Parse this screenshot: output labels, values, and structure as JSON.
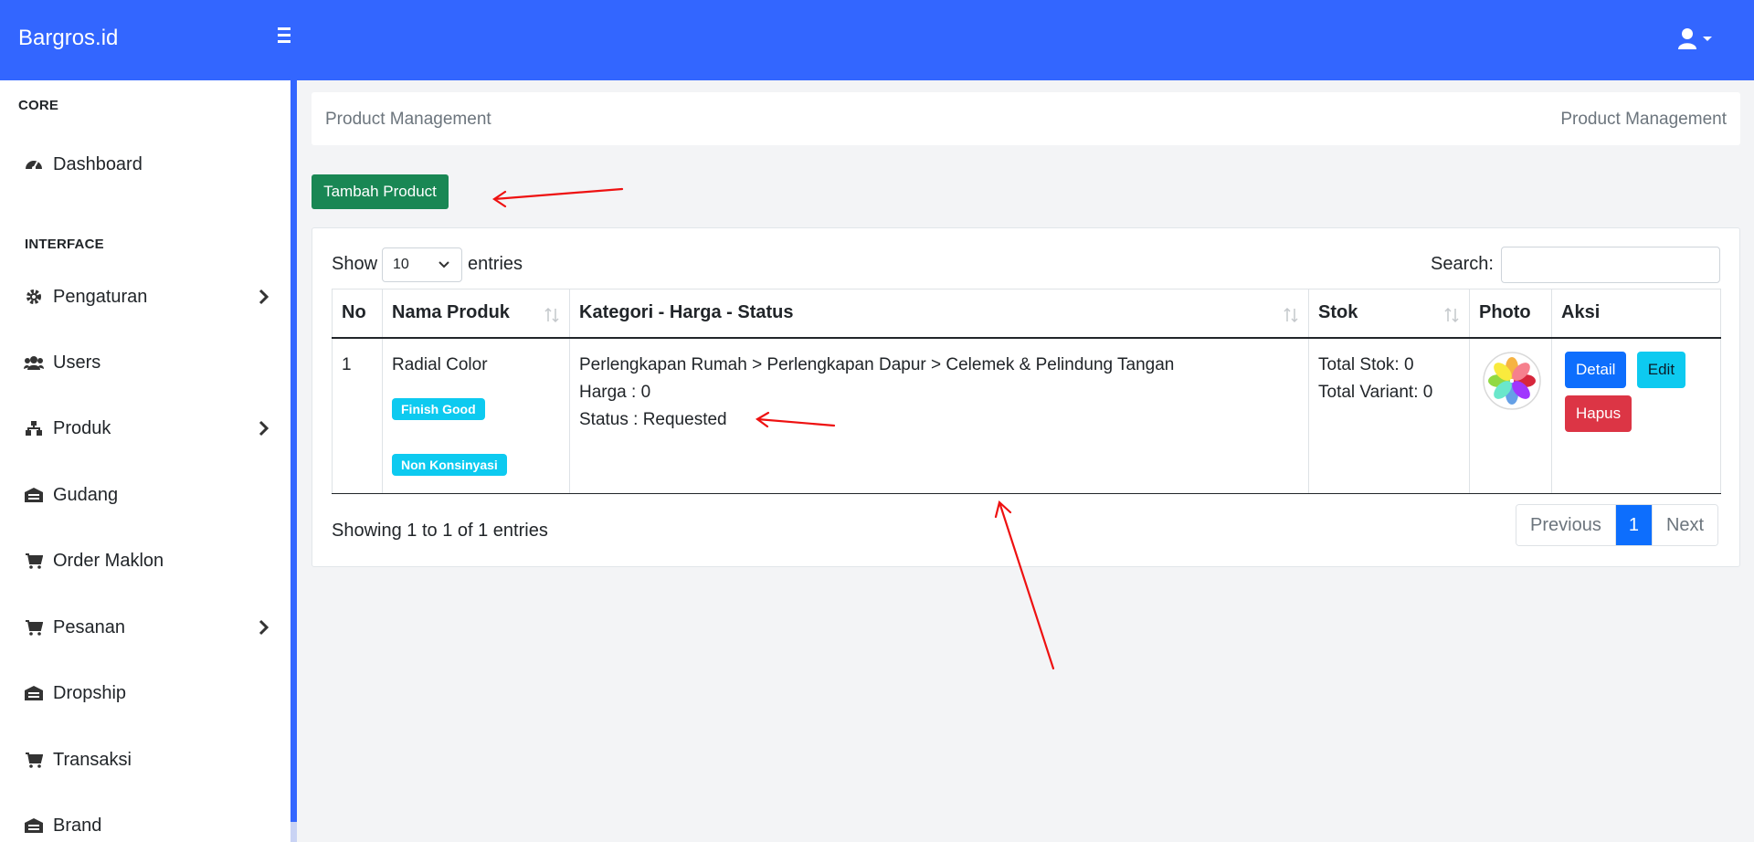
{
  "navbar": {
    "brand": "Bargros.id",
    "menu_icon": "hamburger-icon",
    "user_icon": "user-icon"
  },
  "sidebar": {
    "sections": [
      {
        "heading": "CORE"
      },
      {
        "heading": "INTERFACE"
      }
    ],
    "items": [
      {
        "label": "Dashboard",
        "icon": "gauge-icon"
      },
      {
        "label": "Pengaturan",
        "icon": "gear-icon",
        "has_submenu": true
      },
      {
        "label": "Users",
        "icon": "users-icon"
      },
      {
        "label": "Produk",
        "icon": "sitemap-icon",
        "has_submenu": true
      },
      {
        "label": "Gudang",
        "icon": "warehouse-icon"
      },
      {
        "label": "Order Maklon",
        "icon": "cart-icon"
      },
      {
        "label": "Pesanan",
        "icon": "cart-icon",
        "has_submenu": true
      },
      {
        "label": "Dropship",
        "icon": "warehouse-icon"
      },
      {
        "label": "Transaksi",
        "icon": "cart-icon"
      },
      {
        "label": "Brand",
        "icon": "warehouse-icon"
      }
    ]
  },
  "breadcrumb": {
    "left": "Product Management",
    "right": "Product Management"
  },
  "actions": {
    "add_product": "Tambah Product"
  },
  "table_controls": {
    "show_label": "Show",
    "entries_value": "10",
    "entries_label": "entries",
    "search_label": "Search:",
    "search_value": ""
  },
  "table": {
    "columns": [
      "No",
      "Nama Produk",
      "Kategori - Harga - Status",
      "Stok",
      "Photo",
      "Aksi"
    ],
    "rows": [
      {
        "no": "1",
        "nama": "Radial Color",
        "badges": [
          "Finish Good",
          "Non Konsinyasi"
        ],
        "kategori": "Perlengkapan Rumah > Perlengkapan Dapur > Celemek & Pelindung Tangan",
        "harga": "Harga : 0",
        "status": "Status : Requested",
        "total_stok": "Total Stok: 0",
        "total_variant": "Total Variant: 0",
        "photo_icon": "photos-app-icon",
        "buttons": {
          "detail": "Detail",
          "edit": "Edit",
          "hapus": "Hapus"
        }
      }
    ]
  },
  "footer": {
    "info": "Showing 1 to 1 of 1 entries",
    "pagination": {
      "previous": "Previous",
      "current": "1",
      "next": "Next"
    }
  },
  "colors": {
    "primary": "#3366ff",
    "success": "#198754",
    "info": "#0dcaf0",
    "danger": "#dc3545",
    "blue": "#0d6efd",
    "annotation": "#ee1111"
  }
}
